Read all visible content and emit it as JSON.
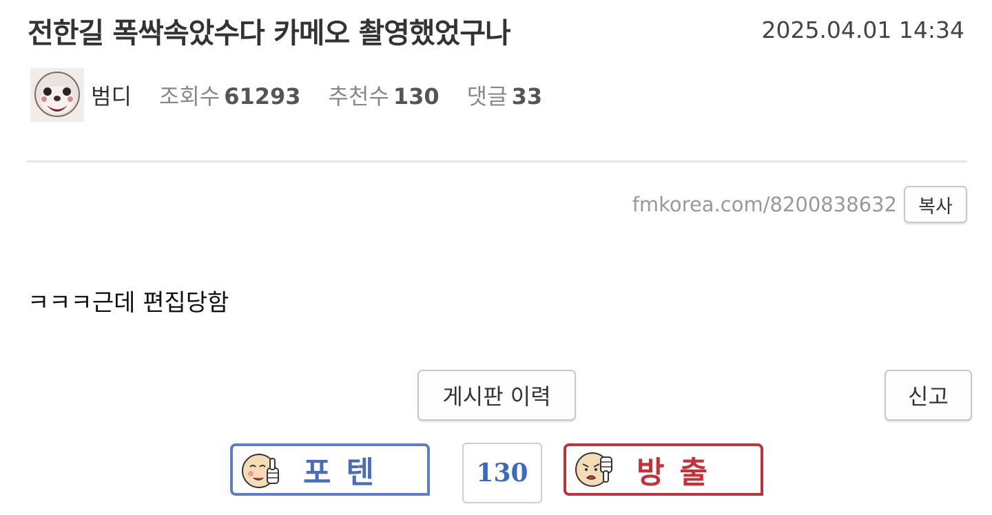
{
  "post": {
    "title": "전한길 폭싹속았수다 카메오 촬영했었구나",
    "date": "2025.04.01 14:34",
    "author": "범디",
    "avatar_icon": "character-face-avatar",
    "stats": [
      {
        "label": "조회수",
        "value": "61293"
      },
      {
        "label": "추천수",
        "value": "130"
      },
      {
        "label": "댓글",
        "value": "33"
      }
    ],
    "url": "fmkorea.com/8200838632",
    "copy_label": "복사",
    "content": "ㅋㅋㅋ근데 편집당함"
  },
  "actions": {
    "history_label": "게시판 이력",
    "report_label": "신고"
  },
  "vote": {
    "up_label": "포텐",
    "down_label": "방출",
    "count": "130",
    "up_color": "#5a7ec9",
    "down_color": "#c0323b",
    "up_icon": "thumbs-up-face-icon",
    "down_icon": "thumbs-down-face-icon"
  }
}
